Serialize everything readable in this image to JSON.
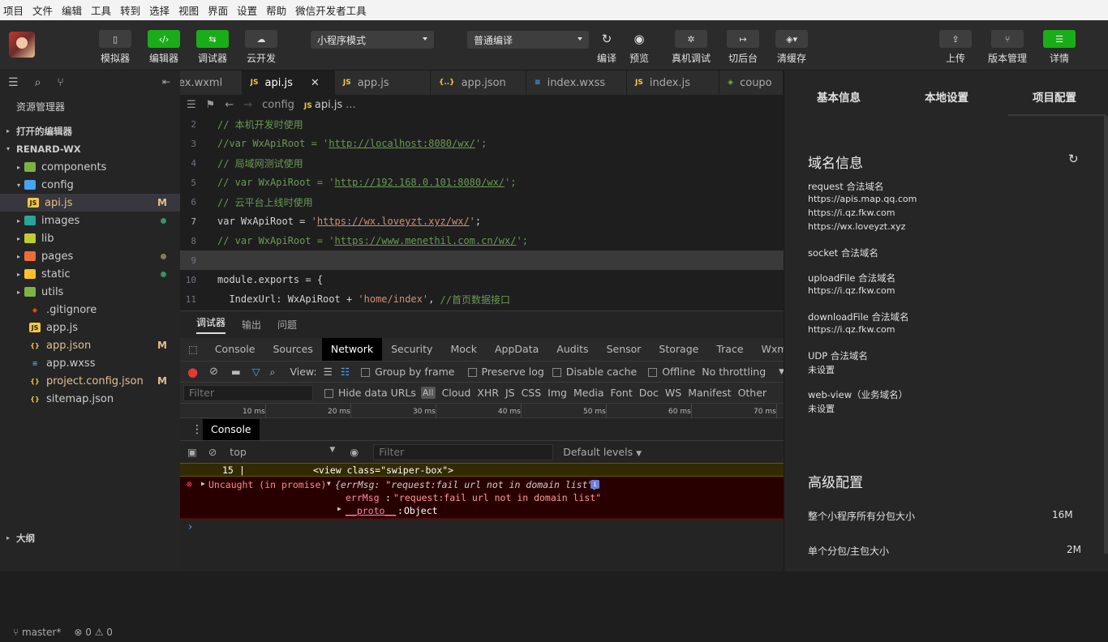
{
  "menubar": [
    "项目",
    "文件",
    "编辑",
    "工具",
    "转到",
    "选择",
    "视图",
    "界面",
    "设置",
    "帮助",
    "微信开发者工具"
  ],
  "toolbar": {
    "left": [
      {
        "label": "模拟器",
        "icon": "phone-icon"
      },
      {
        "label": "编辑器",
        "icon": "code-icon"
      },
      {
        "label": "调试器",
        "icon": "debugger-icon"
      },
      {
        "label": "云开发",
        "icon": "cloud-icon"
      }
    ],
    "mode_select": "小程序模式",
    "compile_select": "普通编译",
    "mid": [
      {
        "label": "编译",
        "icon": "refresh-icon"
      },
      {
        "label": "预览",
        "icon": "eye-icon"
      },
      {
        "label": "真机调试",
        "icon": "bug-icon"
      },
      {
        "label": "切后台",
        "icon": "switch-icon"
      },
      {
        "label": "清缓存",
        "icon": "layers-icon"
      }
    ],
    "right": [
      {
        "label": "上传",
        "icon": "upload-icon"
      },
      {
        "label": "版本管理",
        "icon": "branch-icon"
      },
      {
        "label": "详情",
        "icon": "menu-icon"
      }
    ]
  },
  "sidebar": {
    "title": "资源管理器",
    "open_editors": "打开的编辑器",
    "project": "RENARD-WX",
    "outline": "大纲",
    "tree": [
      {
        "name": "components",
        "type": "folder",
        "color": "#7cb342",
        "level": 1,
        "arrow": "▸",
        "dot": ""
      },
      {
        "name": "config",
        "type": "folder",
        "color": "#42a5f5",
        "level": 1,
        "arrow": "▾",
        "dot": ""
      },
      {
        "name": "api.js",
        "type": "js",
        "color": "#f5c842",
        "level": 2,
        "arrow": "",
        "badge": "M",
        "active": true
      },
      {
        "name": "images",
        "type": "folder",
        "color": "#26a69a",
        "level": 1,
        "arrow": "▸",
        "dot": "#3c8f6a"
      },
      {
        "name": "lib",
        "type": "folder",
        "color": "#c0ca33",
        "level": 1,
        "arrow": "▸",
        "dot": ""
      },
      {
        "name": "pages",
        "type": "folder",
        "color": "#ef6c3a",
        "level": 1,
        "arrow": "▸",
        "dot": "#8a7a5a"
      },
      {
        "name": "static",
        "type": "folder",
        "color": "#fbc02d",
        "level": 1,
        "arrow": "▸",
        "dot": "#3c8f6a"
      },
      {
        "name": "utils",
        "type": "folder",
        "color": "#7cb342",
        "level": 1,
        "arrow": "▸",
        "dot": ""
      },
      {
        "name": ".gitignore",
        "type": "git",
        "color": "#e64a19",
        "level": 1,
        "arrow": "",
        "dot": ""
      },
      {
        "name": "app.js",
        "type": "js",
        "color": "#f5c842",
        "level": 1,
        "arrow": "",
        "dot": ""
      },
      {
        "name": "app.json",
        "type": "json",
        "color": "#f5c842",
        "level": 1,
        "arrow": "",
        "badge": "M"
      },
      {
        "name": "app.wxss",
        "type": "css",
        "color": "#42a5f5",
        "level": 1,
        "arrow": "",
        "dot": ""
      },
      {
        "name": "project.config.json",
        "type": "json",
        "color": "#f5c842",
        "level": 1,
        "arrow": "",
        "badge": "M"
      },
      {
        "name": "sitemap.json",
        "type": "json",
        "color": "#f5c842",
        "level": 1,
        "arrow": "",
        "dot": ""
      }
    ],
    "status_branch": "master*",
    "status_errors": "0",
    "status_warnings": "0"
  },
  "editor": {
    "tabs": [
      {
        "name": "ex.wxml",
        "icon": "‹›",
        "color": "#e8a33d",
        "active": false
      },
      {
        "name": "api.js",
        "icon": "JS",
        "color": "#f5c842",
        "active": true
      },
      {
        "name": "app.js",
        "icon": "JS",
        "color": "#f5c842",
        "active": false
      },
      {
        "name": "app.json",
        "icon": "{..}",
        "color": "#f5c842",
        "active": false
      },
      {
        "name": "index.wxss",
        "icon": "≡",
        "color": "#42a5f5",
        "active": false
      },
      {
        "name": "index.js",
        "icon": "JS",
        "color": "#f5c842",
        "active": false
      },
      {
        "name": "coupo",
        "icon": "◈",
        "color": "#7cb342",
        "active": false
      }
    ],
    "breadcrumb": [
      "config",
      "api.js",
      "..."
    ],
    "lines": [
      {
        "n": "2",
        "parts": [
          {
            "c": "cm",
            "t": "// 本机开发时使用"
          }
        ]
      },
      {
        "n": "3",
        "parts": [
          {
            "c": "cm",
            "t": "//var WxApiRoot = '"
          },
          {
            "c": "cm url",
            "t": "http://localhost:8080/wx/"
          },
          {
            "c": "cm",
            "t": "';"
          }
        ]
      },
      {
        "n": "4",
        "parts": [
          {
            "c": "cm",
            "t": "// 局域网测试使用"
          }
        ]
      },
      {
        "n": "5",
        "parts": [
          {
            "c": "cm",
            "t": "// var WxApiRoot = '"
          },
          {
            "c": "cm url",
            "t": "http://192.168.0.101:8080/wx/"
          },
          {
            "c": "cm",
            "t": "';"
          }
        ]
      },
      {
        "n": "6",
        "parts": [
          {
            "c": "cm",
            "t": "// 云平台上线时使用"
          }
        ]
      },
      {
        "n": "7",
        "parts": [
          {
            "c": "kw",
            "t": "var WxApiRoot = "
          },
          {
            "c": "str",
            "t": "'"
          },
          {
            "c": "str url",
            "t": "https://wx.loveyzt.xyz/wx/"
          },
          {
            "c": "str",
            "t": "'"
          },
          {
            "c": "kw",
            "t": ";"
          }
        ]
      },
      {
        "n": "8",
        "parts": [
          {
            "c": "cm",
            "t": "// var WxApiRoot = '"
          },
          {
            "c": "cm url",
            "t": "https://www.menethil.com.cn/wx/"
          },
          {
            "c": "cm",
            "t": "';"
          }
        ]
      },
      {
        "n": "9",
        "parts": [],
        "hl": true
      },
      {
        "n": "10",
        "parts": [
          {
            "c": "kw",
            "t": "module.exports = {"
          }
        ]
      },
      {
        "n": "11",
        "parts": [
          {
            "c": "kw",
            "t": "  IndexUrl: WxApiRoot + "
          },
          {
            "c": "str",
            "t": "'home/index'"
          },
          {
            "c": "kw",
            "t": ", "
          },
          {
            "c": "cm",
            "t": "//首页数据接口"
          }
        ]
      }
    ]
  },
  "panel": {
    "tabs": [
      "调试器",
      "输出",
      "问题"
    ],
    "devtabs": [
      "Console",
      "Sources",
      "Network",
      "Security",
      "Mock",
      "AppData",
      "Audits",
      "Sensor",
      "Storage",
      "Trace",
      "Wxml"
    ],
    "active_devtab": "Network",
    "net_view": "View:",
    "group_by_frame": "Group by frame",
    "preserve_log": "Preserve log",
    "disable_cache": "Disable cache",
    "offline": "Offline",
    "throttling": "No throttling",
    "filter_placeholder": "Filter",
    "hide_data_urls": "Hide data URLs",
    "types": [
      "All",
      "Cloud",
      "XHR",
      "JS",
      "CSS",
      "Img",
      "Media",
      "Font",
      "Doc",
      "WS",
      "Manifest",
      "Other"
    ],
    "timeline": [
      "10 ms",
      "20 ms",
      "30 ms",
      "40 ms",
      "50 ms",
      "60 ms",
      "70 ms"
    ],
    "console_tab": "Console",
    "context": "top",
    "console_filter": "Filter",
    "levels": "Default levels",
    "warn_line_no": "15",
    "warn_code": "<view class=\"swiper-box\">",
    "err_prefix": "Uncaught (in promise)",
    "err_obj": "{errMsg: \"request:fail url not in domain list\"}",
    "err_key": "errMsg",
    "err_val": "\"request:fail url not in domain list\"",
    "proto_key": "__proto__",
    "proto_val": "Object"
  },
  "right": {
    "tabs": [
      "基本信息",
      "本地设置",
      "项目配置"
    ],
    "domain_title": "域名信息",
    "request_label": "request 合法域名",
    "request_values": [
      "https://apis.map.qq.com",
      "https://i.qz.fkw.com",
      "https://wx.loveyzt.xyz"
    ],
    "socket_label": "socket 合法域名",
    "upload_label": "uploadFile 合法域名",
    "upload_value": "https://i.qz.fkw.com",
    "download_label": "downloadFile 合法域名",
    "download_value": "https://i.qz.fkw.com",
    "udp_label": "UDP 合法域名",
    "udp_value": "未设置",
    "webview_label": "web-view（业务域名）",
    "webview_value": "未设置",
    "advanced_title": "高级配置",
    "total_pkg_label": "整个小程序所有分包大小",
    "total_pkg_value": "16M",
    "single_pkg_label": "单个分包/主包大小",
    "single_pkg_value": "2M"
  },
  "colors": {
    "accent_green": "#1aad19",
    "error_bg": "#290000",
    "warn_bg": "#332b00"
  }
}
